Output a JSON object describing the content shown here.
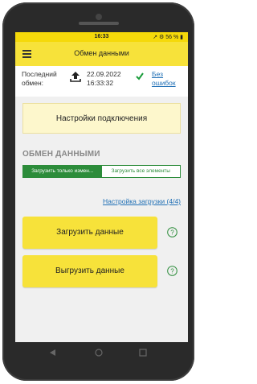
{
  "statusbar": {
    "time": "16:33",
    "right": "↗ ⚙ 56 % ▮"
  },
  "appbar": {
    "title": "Обмен данными",
    "menu_icon": "hamburger-icon"
  },
  "exchange": {
    "label": "Последний обмен:",
    "date": "22.09.2022",
    "time": "16:33:32",
    "status": "Без ошибок",
    "status_color": "#1a9c3a"
  },
  "connection_settings": {
    "label": "Настройки подключения"
  },
  "section": {
    "title": "ОБМЕН ДАННЫМИ"
  },
  "tabs": [
    {
      "label": "Загрузить только измен...",
      "active": true
    },
    {
      "label": "Загрузить все элементы",
      "active": false
    }
  ],
  "load_settings_link": "Настройка загрузки (4/4)",
  "buttons": {
    "download": "Загрузить данные",
    "upload": "Выгрузить данные"
  },
  "colors": {
    "accent": "#f7e23a",
    "green": "#2c8c3a",
    "link": "#1f6fb5"
  }
}
